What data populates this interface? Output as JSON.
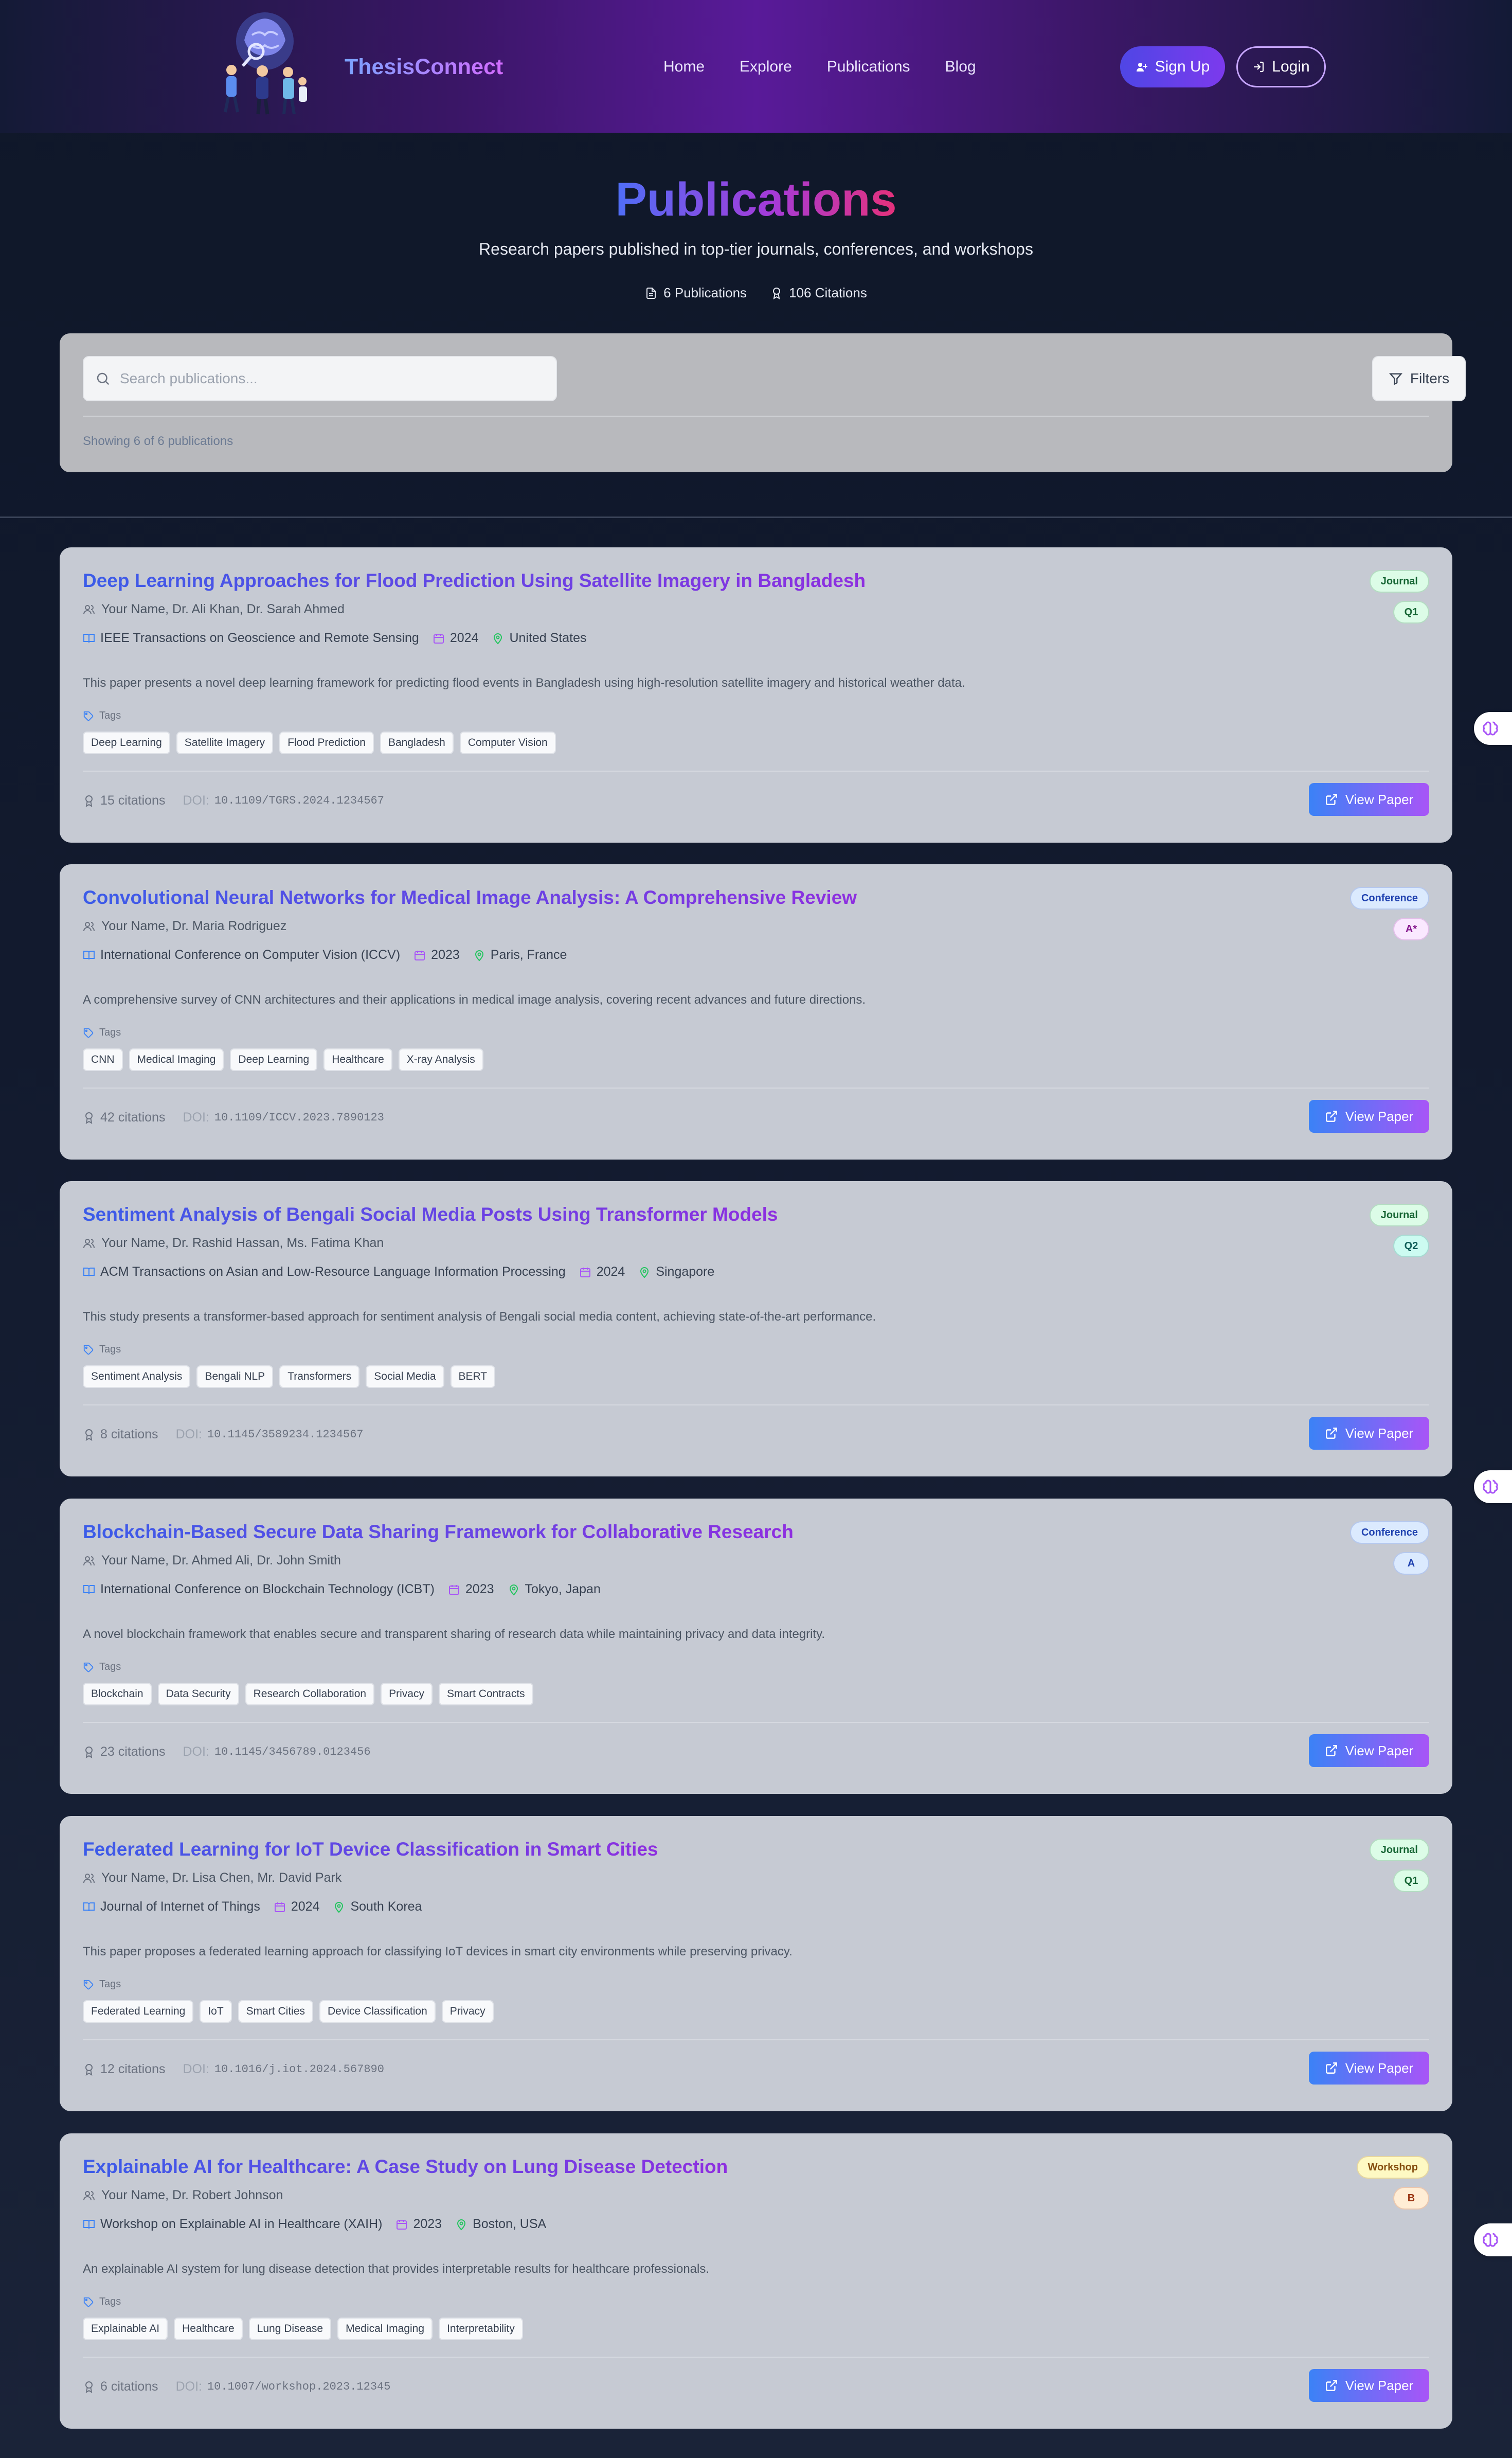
{
  "header": {
    "brand": "ThesisConnect",
    "nav": [
      "Home",
      "Explore",
      "Publications",
      "Blog"
    ],
    "signup_label": "Sign Up",
    "login_label": "Login"
  },
  "hero": {
    "title": "Publications",
    "subtitle": "Research papers published in top-tier journals, conferences, and workshops",
    "publications_count": "6 Publications",
    "citations_count": "106 Citations"
  },
  "search": {
    "placeholder": "Search publications...",
    "filters_label": "Filters",
    "showing_text": "Showing 6 of 6 publications"
  },
  "card_labels": {
    "tags_label": "Tags",
    "doi_label": "DOI:",
    "view_label": "View Paper"
  },
  "colors": {
    "journal_badge_bg": "#dcfce7",
    "journal_badge_fg": "#166534",
    "conference_badge_bg": "#dbeafe",
    "conference_badge_fg": "#1e40af",
    "workshop_badge_bg": "#fef9c3",
    "workshop_badge_fg": "#854d0e"
  },
  "publications": [
    {
      "title": "Deep Learning Approaches for Flood Prediction Using Satellite Imagery in Bangladesh",
      "authors": "Your Name, Dr. Ali Khan, Dr. Sarah Ahmed",
      "venue": "IEEE Transactions on Geoscience and Remote Sensing",
      "year": "2024",
      "location": "United States",
      "abstract": "This paper presents a novel deep learning framework for predicting flood events in Bangladesh using high-resolution satellite imagery and historical weather data.",
      "tags": [
        "Deep Learning",
        "Satellite Imagery",
        "Flood Prediction",
        "Bangladesh",
        "Computer Vision"
      ],
      "citations": "15 citations",
      "doi": "10.1109/TGRS.2024.1234567",
      "type": "Journal",
      "rank": "Q1"
    },
    {
      "title": "Convolutional Neural Networks for Medical Image Analysis: A Comprehensive Review",
      "authors": "Your Name, Dr. Maria Rodriguez",
      "venue": "International Conference on Computer Vision (ICCV)",
      "year": "2023",
      "location": "Paris, France",
      "abstract": "A comprehensive survey of CNN architectures and their applications in medical image analysis, covering recent advances and future directions.",
      "tags": [
        "CNN",
        "Medical Imaging",
        "Deep Learning",
        "Healthcare",
        "X-ray Analysis"
      ],
      "citations": "42 citations",
      "doi": "10.1109/ICCV.2023.7890123",
      "type": "Conference",
      "rank": "A*"
    },
    {
      "title": "Sentiment Analysis of Bengali Social Media Posts Using Transformer Models",
      "authors": "Your Name, Dr. Rashid Hassan, Ms. Fatima Khan",
      "venue": "ACM Transactions on Asian and Low-Resource Language Information Processing",
      "year": "2024",
      "location": "Singapore",
      "abstract": "This study presents a transformer-based approach for sentiment analysis of Bengali social media content, achieving state-of-the-art performance.",
      "tags": [
        "Sentiment Analysis",
        "Bengali NLP",
        "Transformers",
        "Social Media",
        "BERT"
      ],
      "citations": "8 citations",
      "doi": "10.1145/3589234.1234567",
      "type": "Journal",
      "rank": "Q2"
    },
    {
      "title": "Blockchain-Based Secure Data Sharing Framework for Collaborative Research",
      "authors": "Your Name, Dr. Ahmed Ali, Dr. John Smith",
      "venue": "International Conference on Blockchain Technology (ICBT)",
      "year": "2023",
      "location": "Tokyo, Japan",
      "abstract": "A novel blockchain framework that enables secure and transparent sharing of research data while maintaining privacy and data integrity.",
      "tags": [
        "Blockchain",
        "Data Security",
        "Research Collaboration",
        "Privacy",
        "Smart Contracts"
      ],
      "citations": "23 citations",
      "doi": "10.1145/3456789.0123456",
      "type": "Conference",
      "rank": "A"
    },
    {
      "title": "Federated Learning for IoT Device Classification in Smart Cities",
      "authors": "Your Name, Dr. Lisa Chen, Mr. David Park",
      "venue": "Journal of Internet of Things",
      "year": "2024",
      "location": "South Korea",
      "abstract": "This paper proposes a federated learning approach for classifying IoT devices in smart city environments while preserving privacy.",
      "tags": [
        "Federated Learning",
        "IoT",
        "Smart Cities",
        "Device Classification",
        "Privacy"
      ],
      "citations": "12 citations",
      "doi": "10.1016/j.iot.2024.567890",
      "type": "Journal",
      "rank": "Q1"
    },
    {
      "title": "Explainable AI for Healthcare: A Case Study on Lung Disease Detection",
      "authors": "Your Name, Dr. Robert Johnson",
      "venue": "Workshop on Explainable AI in Healthcare (XAIH)",
      "year": "2023",
      "location": "Boston, USA",
      "abstract": "An explainable AI system for lung disease detection that provides interpretable results for healthcare professionals.",
      "tags": [
        "Explainable AI",
        "Healthcare",
        "Lung Disease",
        "Medical Imaging",
        "Interpretability"
      ],
      "citations": "6 citations",
      "doi": "10.1007/workshop.2023.12345",
      "type": "Workshop",
      "rank": "B"
    }
  ]
}
